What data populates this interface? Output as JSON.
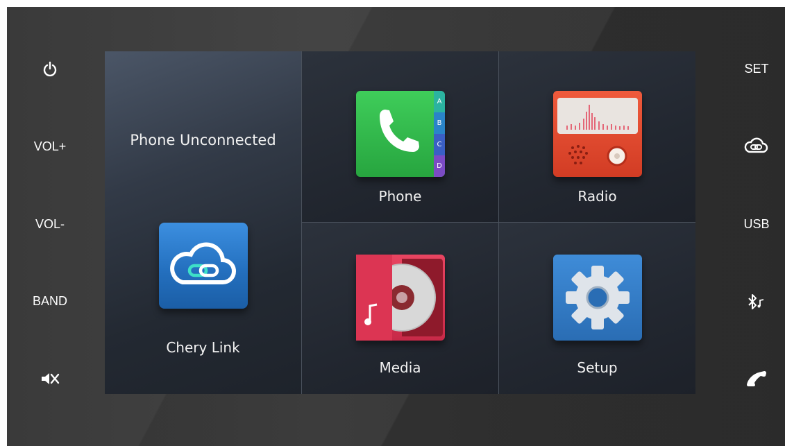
{
  "left_keys": {
    "power_icon": "power-icon",
    "vol_up": "VOL+",
    "vol_down": "VOL-",
    "band": "BAND",
    "mute_icon": "mute-icon"
  },
  "right_keys": {
    "set": "SET",
    "link_icon": "cloud-link-icon",
    "usb": "USB",
    "bluetooth_icon": "bluetooth-music-icon",
    "call_icon": "phone-handset-icon"
  },
  "home": {
    "chery_link": {
      "status": "Phone Unconnected",
      "label": "Chery Link",
      "icon": "cloud-link-icon"
    },
    "phone": {
      "label": "Phone",
      "icon": "phone-contacts-icon",
      "tabs": [
        "A",
        "B",
        "C",
        "D"
      ]
    },
    "radio": {
      "label": "Radio",
      "icon": "radio-icon"
    },
    "media": {
      "label": "Media",
      "icon": "media-disc-icon"
    },
    "setup": {
      "label": "Setup",
      "icon": "gear-icon"
    }
  },
  "colors": {
    "bezel": "#3d3d3d",
    "screen_bg": "#1f242c",
    "phone_green": "#2fb24a",
    "radio_red": "#e0472f",
    "media_red": "#d9374f",
    "setup_blue": "#2b74c0",
    "link_blue": "#2b78c8"
  }
}
